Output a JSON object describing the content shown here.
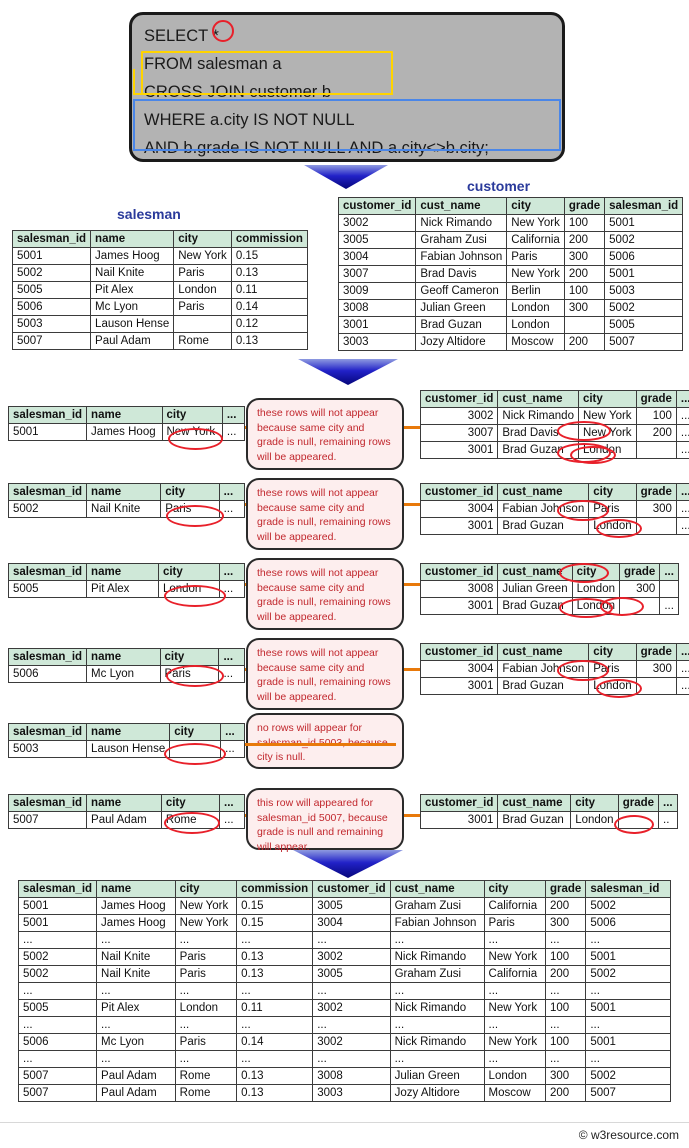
{
  "query": {
    "lines": [
      "SELECT  *",
      "FROM   salesman a",
      "CROSS JOIN customer b",
      "WHERE a.city IS NOT NULL",
      "AND b.grade  IS NOT NULL  AND a.city<>b.city;"
    ],
    "highlight_colors": {
      "from_join_box": "#ffd400",
      "where_box": "#4a86e8",
      "star_circle": "#e8202a",
      "box_background": "#b3b3b3"
    }
  },
  "salesman_table": {
    "title": "salesman",
    "columns": [
      "salesman_id",
      "name",
      "city",
      "commission"
    ],
    "rows": [
      [
        "5001",
        "James Hoog",
        "New York",
        "0.15"
      ],
      [
        "5002",
        "Nail Knite",
        "Paris",
        "0.13"
      ],
      [
        "5005",
        "Pit Alex",
        "London",
        "0.11"
      ],
      [
        "5006",
        "Mc Lyon",
        "Paris",
        "0.14"
      ],
      [
        "5003",
        "Lauson Hense",
        "",
        "0.12"
      ],
      [
        "5007",
        "Paul Adam",
        "Rome",
        "0.13"
      ]
    ]
  },
  "customer_table": {
    "title": "customer",
    "columns": [
      "customer_id",
      "cust_name",
      "city",
      "grade",
      "salesman_id"
    ],
    "rows": [
      [
        "3002",
        "Nick Rimando",
        "New York",
        "100",
        "5001"
      ],
      [
        "3005",
        "Graham Zusi",
        "California",
        "200",
        "5002"
      ],
      [
        "3004",
        "Fabian Johnson",
        "Paris",
        "300",
        "5006"
      ],
      [
        "3007",
        "Brad Davis",
        "New York",
        "200",
        "5001"
      ],
      [
        "3009",
        "Geoff Cameron",
        "Berlin",
        "100",
        "5003"
      ],
      [
        "3008",
        "Julian Green",
        "London",
        "300",
        "5002"
      ],
      [
        "3001",
        "Brad Guzan",
        "London",
        "",
        "5005"
      ],
      [
        "3003",
        "Jozy Altidore",
        "Moscow",
        "200",
        "5007"
      ]
    ]
  },
  "blocks": [
    {
      "left_columns": [
        "salesman_id",
        "name",
        "city",
        "..."
      ],
      "left_rows": [
        [
          "5001",
          "James Hoog",
          "New York",
          "..."
        ]
      ],
      "note": "these rows will not appear because same city and grade is null, remaining rows will be appeared.",
      "right_columns": [
        "customer_id",
        "cust_name",
        "city",
        "grade",
        "..."
      ],
      "right_rows": [
        [
          "3002",
          "Nick Rimando",
          "New York",
          "100",
          "..."
        ],
        [
          "3007",
          "Brad Davis",
          "New York",
          "200",
          "..."
        ],
        [
          "3001",
          "Brad Guzan",
          "London",
          "",
          "..."
        ]
      ]
    },
    {
      "left_columns": [
        "salesman_id",
        "name",
        "city",
        "..."
      ],
      "left_rows": [
        [
          "5002",
          "Nail Knite",
          "Paris",
          "..."
        ]
      ],
      "note": "these rows will not appear because same city and grade is null, remaining rows will be appeared.",
      "right_columns": [
        "customer_id",
        "cust_name",
        "city",
        "grade",
        "..."
      ],
      "right_rows": [
        [
          "3004",
          "Fabian Johnson",
          "Paris",
          "300",
          "..."
        ],
        [
          "3001",
          "Brad Guzan",
          "London",
          "",
          "..."
        ]
      ]
    },
    {
      "left_columns": [
        "salesman_id",
        "name",
        "city",
        "..."
      ],
      "left_rows": [
        [
          "5005",
          "Pit Alex",
          "London",
          "..."
        ]
      ],
      "note": "these rows will not appear because same city and grade is null, remaining rows will be appeared.",
      "right_columns": [
        "customer_id",
        "cust_name",
        "city",
        "grade",
        "..."
      ],
      "right_rows": [
        [
          "3008",
          "Julian Green",
          "London",
          "300",
          ""
        ],
        [
          "3001",
          "Brad Guzan",
          "London",
          "",
          "..."
        ]
      ]
    },
    {
      "left_columns": [
        "salesman_id",
        "name",
        "city",
        "..."
      ],
      "left_rows": [
        [
          "5006",
          "Mc Lyon",
          "Paris",
          "..."
        ]
      ],
      "note": "these rows will not appear because same city and grade is null, remaining rows will be appeared.",
      "right_columns": [
        "customer_id",
        "cust_name",
        "city",
        "grade",
        "..."
      ],
      "right_rows": [
        [
          "3004",
          "Fabian Johnson",
          "Paris",
          "300",
          "..."
        ],
        [
          "3001",
          "Brad Guzan",
          "London",
          "",
          "..."
        ]
      ]
    },
    {
      "left_columns": [
        "salesman_id",
        "name",
        "city",
        "..."
      ],
      "left_rows": [
        [
          "5003",
          "Lauson Hense",
          "",
          "..."
        ]
      ],
      "note": "no rows will appear for salesman_id 5003, because city is null.",
      "right_columns": [],
      "right_rows": []
    },
    {
      "left_columns": [
        "salesman_id",
        "name",
        "city",
        "..."
      ],
      "left_rows": [
        [
          "5007",
          "Paul Adam",
          "Rome",
          "..."
        ]
      ],
      "note": "this row will appeared for salesman_id 5007, because grade is null and remaining will appear.",
      "right_columns": [
        "customer_id",
        "cust_name",
        "city",
        "grade",
        "..."
      ],
      "right_rows": [
        [
          "3001",
          "Brad Guzan",
          "London",
          "",
          ".."
        ]
      ]
    }
  ],
  "result_table": {
    "columns": [
      "salesman_id",
      "name",
      "city",
      "commission",
      "customer_id",
      "cust_name",
      "city",
      "grade",
      "salesman_id"
    ],
    "rows": [
      [
        "5001",
        "James Hoog",
        "New York",
        "0.15",
        "3005",
        "Graham Zusi",
        "California",
        "200",
        "5002"
      ],
      [
        "5001",
        "James Hoog",
        "New York",
        "0.15",
        "3004",
        "Fabian Johnson",
        "Paris",
        "300",
        "5006"
      ],
      [
        "...",
        "...",
        "...",
        "...",
        "...",
        "...",
        "...",
        "...",
        "..."
      ],
      [
        "5002",
        "Nail Knite",
        "Paris",
        "0.13",
        "3002",
        "Nick Rimando",
        "New York",
        "100",
        "5001"
      ],
      [
        "5002",
        "Nail Knite",
        "Paris",
        "0.13",
        "3005",
        "Graham Zusi",
        "California",
        "200",
        "5002"
      ],
      [
        "...",
        "...",
        "...",
        "...",
        "...",
        "...",
        "...",
        "...",
        "..."
      ],
      [
        "5005",
        "Pit Alex",
        "London",
        "0.11",
        "3002",
        "Nick Rimando",
        "New York",
        "100",
        "5001"
      ],
      [
        "...",
        "...",
        "...",
        "...",
        "...",
        "...",
        "...",
        "...",
        "..."
      ],
      [
        "5006",
        "Mc Lyon",
        "Paris",
        "0.14",
        "3002",
        "Nick Rimando",
        "New York",
        "100",
        "5001"
      ],
      [
        "...",
        "...",
        "...",
        "...",
        "...",
        "...",
        "...",
        "...",
        "..."
      ],
      [
        "5007",
        "Paul Adam",
        "Rome",
        "0.13",
        "3008",
        "Julian Green",
        "London",
        "300",
        "5002"
      ],
      [
        "5007",
        "Paul Adam",
        "Rome",
        "0.13",
        "3003",
        "Jozy Altidore",
        "Moscow",
        "200",
        "5007"
      ]
    ]
  },
  "footer": {
    "copyright": "© w3resource.com"
  }
}
